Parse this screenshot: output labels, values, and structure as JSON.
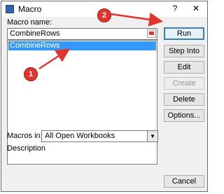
{
  "window": {
    "title": "Macro",
    "help_icon": "?",
    "close_icon": "✕"
  },
  "macro_name": {
    "label": "Macro name:",
    "value": "CombineRows"
  },
  "macro_list": {
    "items": [
      "CombineRows"
    ],
    "selected_index": 0
  },
  "buttons": {
    "run": "Run",
    "step_into": "Step Into",
    "edit": "Edit",
    "create": "Create",
    "delete": "Delete",
    "options": "Options...",
    "cancel": "Cancel"
  },
  "macros_in": {
    "label": "Macros in:",
    "value": "All Open Workbooks"
  },
  "description": {
    "label": "Description"
  },
  "annotations": {
    "badge_1": "1",
    "badge_2": "2",
    "color": "#e0352a"
  },
  "colors": {
    "selection": "#3399ff",
    "default_button_border": "#3c7fb1"
  }
}
